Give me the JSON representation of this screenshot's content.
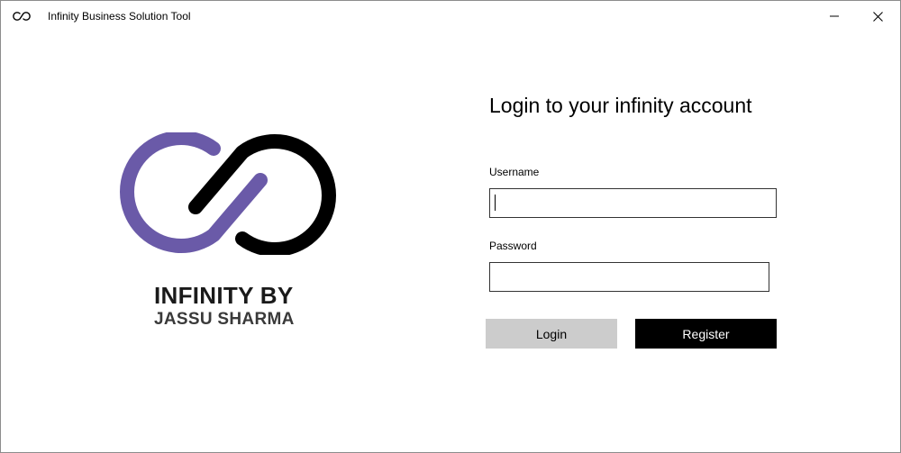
{
  "window": {
    "title": "Infinity Business Solution Tool",
    "icon": "infinity-icon",
    "controls": {
      "minimize_icon": "minimize-icon",
      "close_icon": "close-icon"
    }
  },
  "brand": {
    "logo_icon": "infinity-logo",
    "line1": "INFINITY BY",
    "line2": "JASSU SHARMA",
    "colors": {
      "purple": "#6a5aa8",
      "black": "#000000"
    }
  },
  "login": {
    "title": "Login to your infinity account",
    "username": {
      "label": "Username",
      "value": ""
    },
    "password": {
      "label": "Password",
      "value": ""
    },
    "login_label": "Login",
    "register_label": "Register"
  }
}
